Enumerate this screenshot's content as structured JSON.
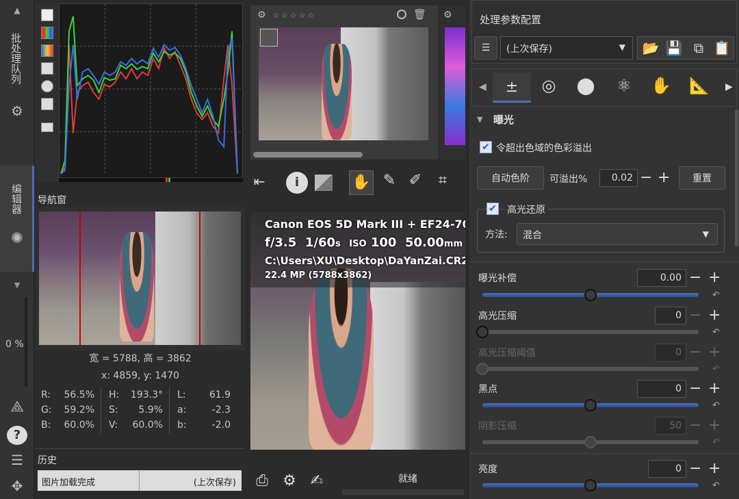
{
  "left_tabs": {
    "batch_queue": "批处理队列",
    "editor": "编辑器",
    "zoom_percent": "0 %"
  },
  "navigator": {
    "title": "导航窗",
    "size_line": "宽 = 5788, 高 = 3862",
    "coords_line": "x: 4859, y: 1470",
    "r_label": "R:",
    "r_value": "56.5%",
    "g_label": "G:",
    "g_value": "59.2%",
    "b_label": "B:",
    "b_value": "60.0%",
    "h_label": "H:",
    "h_value": "193.3°",
    "s_label": "S:",
    "s_value": "5.9%",
    "v_label": "V:",
    "v_value": "60.0%",
    "l_label": "L:",
    "l_value": "61.9",
    "a_label": "a:",
    "a_value": "-2.3",
    "bb_label": "b:",
    "bb_value": "-2.0"
  },
  "history": {
    "title": "历史",
    "entry_name": "图片加载完成",
    "entry_state": "(上次保存)"
  },
  "preview": {
    "exif_camera": "Canon EOS 5D Mark III + EF24-70",
    "exif_fnum": "f/3.5",
    "exif_shutter": "1/60",
    "exif_shutter_unit": "s",
    "exif_iso_label": "ISO",
    "exif_iso": "100",
    "exif_focal": "50.00",
    "exif_focal_unit": "mm",
    "exif_path": "C:\\Users\\XU\\Desktop\\DaYanZai.CR2",
    "exif_mp": "22.4 MP (5788x3862)"
  },
  "status": {
    "ready": "就绪"
  },
  "profile": {
    "title": "处理参数配置",
    "selected": "(上次保存)"
  },
  "exposure": {
    "section_title": "曝光",
    "clip_oog_label": "令超出色域的色彩溢出",
    "auto_levels_button": "自动色阶",
    "clip_label": "可溢出%",
    "clip_value": "0.02",
    "reset_button": "重置",
    "highlight_recovery_label": "高光还原",
    "method_label": "方法:",
    "method_value": "混合",
    "comp_label": "曝光补偿",
    "comp_value": "0.00",
    "comp_level": 0.5,
    "hl_comp_label": "高光压缩",
    "hl_comp_value": "0",
    "hl_comp_level": 0.0,
    "hl_thresh_label": "高光压缩阈值",
    "hl_thresh_value": "0",
    "hl_thresh_level": 0.0,
    "black_label": "黑点",
    "black_value": "0",
    "black_level": 0.5,
    "shadow_comp_label": "阴影压缩",
    "shadow_comp_value": "50",
    "shadow_comp_level": 0.5,
    "lightness_label": "亮度",
    "lightness_value": "0",
    "lightness_level": 0.5
  },
  "colors": {
    "accent": "#4a6fb5",
    "panel": "#333333",
    "button": "#3c3c3c"
  }
}
